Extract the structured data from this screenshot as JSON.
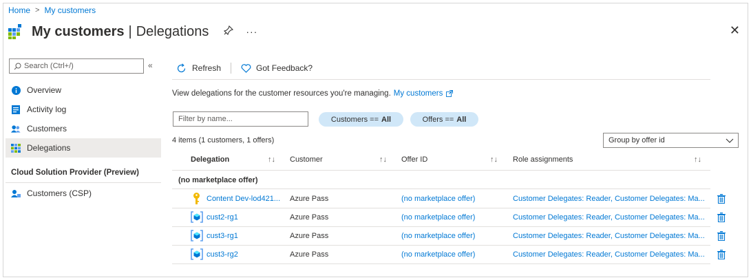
{
  "breadcrumb": {
    "home": "Home",
    "separator": ">",
    "current": "My customers"
  },
  "header": {
    "title_bold": "My customers",
    "pipe": "|",
    "title_rest": "Delegations",
    "pin_icon": "pin-icon",
    "more": "···",
    "close": "✕"
  },
  "sidebar": {
    "search_placeholder": "Search (Ctrl+/)",
    "collapse": "«",
    "items": [
      {
        "label": "Overview",
        "icon": "info-icon"
      },
      {
        "label": "Activity log",
        "icon": "activity-log-icon"
      },
      {
        "label": "Customers",
        "icon": "customers-icon"
      },
      {
        "label": "Delegations",
        "icon": "delegations-icon",
        "active": true
      }
    ],
    "section_title": "Cloud Solution Provider (Preview)",
    "csp_item": {
      "label": "Customers (CSP)",
      "icon": "customers-csp-icon"
    }
  },
  "toolbar": {
    "refresh": "Refresh",
    "feedback": "Got Feedback?"
  },
  "intro": {
    "text": "View delegations for the customer resources you're managing.",
    "link": "My customers"
  },
  "filters": {
    "name_placeholder": "Filter by name...",
    "customers_pill": {
      "label": "Customers ==",
      "value": "All"
    },
    "offers_pill": {
      "label": "Offers ==",
      "value": "All"
    }
  },
  "summary": "4 items (1 customers, 1 offers)",
  "groupby": {
    "value": "Group by offer id"
  },
  "table": {
    "headers": {
      "delegation": "Delegation",
      "customer": "Customer",
      "offer_id": "Offer ID",
      "role_assignments": "Role assignments"
    },
    "sort_glyph": "↑↓",
    "group": "(no marketplace offer)",
    "rows": [
      {
        "delegation": "Content Dev-lod421...",
        "icon": "key-icon",
        "customer": "Azure Pass",
        "offer": "(no marketplace offer)",
        "roles": "Customer Delegates: Reader, Customer Delegates: Ma..."
      },
      {
        "delegation": "cust2-rg1",
        "icon": "resource-group-icon",
        "customer": "Azure Pass",
        "offer": "(no marketplace offer)",
        "roles": "Customer Delegates: Reader, Customer Delegates: Ma..."
      },
      {
        "delegation": "cust3-rg1",
        "icon": "resource-group-icon",
        "customer": "Azure Pass",
        "offer": "(no marketplace offer)",
        "roles": "Customer Delegates: Reader, Customer Delegates: Ma..."
      },
      {
        "delegation": "cust3-rg2",
        "icon": "resource-group-icon",
        "customer": "Azure Pass",
        "offer": "(no marketplace offer)",
        "roles": "Customer Delegates: Reader, Customer Delegates: Ma..."
      }
    ]
  },
  "colors": {
    "accent": "#0078d4",
    "pill_bg": "#d0e7f8",
    "active_bg": "#edebe9",
    "key": "#f2b900"
  }
}
